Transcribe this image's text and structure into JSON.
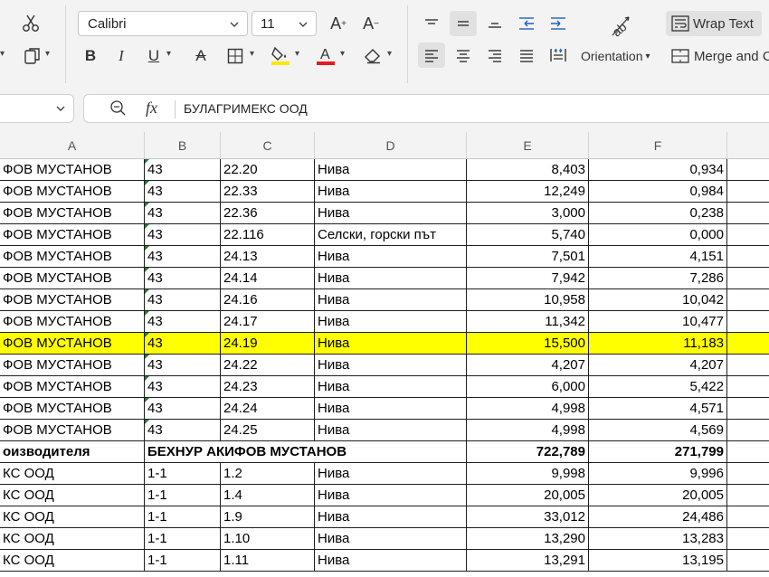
{
  "ribbon": {
    "font_name": "Calibri",
    "font_size": "11",
    "wrap_text_label": "Wrap Text",
    "orientation_label": "Orientation",
    "merge_label": "Merge and Ce",
    "accent_font_color": "#e51c23",
    "accent_fill_color": "#ffe600"
  },
  "formula_bar": {
    "fx_label": "fx",
    "content": "БУЛАГРИМЕКС ООД"
  },
  "columns": [
    "A",
    "B",
    "C",
    "D",
    "E",
    "F"
  ],
  "rows": [
    {
      "a": "ФОВ МУСТАНОВ",
      "b": "43",
      "c": "22.20",
      "d": "Нива",
      "e": "8,403",
      "f": "0,934",
      "mark": true
    },
    {
      "a": "ФОВ МУСТАНОВ",
      "b": "43",
      "c": "22.33",
      "d": "Нива",
      "e": "12,249",
      "f": "0,984",
      "mark": true
    },
    {
      "a": "ФОВ МУСТАНОВ",
      "b": "43",
      "c": "22.36",
      "d": "Нива",
      "e": "3,000",
      "f": "0,238",
      "mark": true
    },
    {
      "a": "ФОВ МУСТАНОВ",
      "b": "43",
      "c": "22.116",
      "d": "Селски, горски път",
      "e": "5,740",
      "f": "0,000",
      "mark": true
    },
    {
      "a": "ФОВ МУСТАНОВ",
      "b": "43",
      "c": "24.13",
      "d": "Нива",
      "e": "7,501",
      "f": "4,151",
      "mark": true
    },
    {
      "a": "ФОВ МУСТАНОВ",
      "b": "43",
      "c": "24.14",
      "d": "Нива",
      "e": "7,942",
      "f": "7,286",
      "mark": true
    },
    {
      "a": "ФОВ МУСТАНОВ",
      "b": "43",
      "c": "24.16",
      "d": "Нива",
      "e": "10,958",
      "f": "10,042",
      "mark": true
    },
    {
      "a": "ФОВ МУСТАНОВ",
      "b": "43",
      "c": "24.17",
      "d": "Нива",
      "e": "11,342",
      "f": "10,477",
      "mark": true
    },
    {
      "a": "ФОВ МУСТАНОВ",
      "b": "43",
      "c": "24.19",
      "d": "Нива",
      "e": "15,500",
      "f": "11,183",
      "mark": true,
      "highlight": true
    },
    {
      "a": "ФОВ МУСТАНОВ",
      "b": "43",
      "c": "24.22",
      "d": "Нива",
      "e": "4,207",
      "f": "4,207",
      "mark": true
    },
    {
      "a": "ФОВ МУСТАНОВ",
      "b": "43",
      "c": "24.23",
      "d": "Нива",
      "e": "6,000",
      "f": "5,422",
      "mark": true
    },
    {
      "a": "ФОВ МУСТАНОВ",
      "b": "43",
      "c": "24.24",
      "d": "Нива",
      "e": "4,998",
      "f": "4,571",
      "mark": true
    },
    {
      "a": "ФОВ МУСТАНОВ",
      "b": "43",
      "c": "24.25",
      "d": "Нива",
      "e": "4,998",
      "f": "4,569",
      "mark": true
    },
    {
      "a": "оизводителя",
      "b": "БЕХНУР АКИФОВ МУСТАНОВ",
      "c": "",
      "d": "",
      "e": "722,789",
      "f": "271,799",
      "bold": true,
      "span": true
    },
    {
      "a": "КС ООД",
      "b": "1-1",
      "c": "1.2",
      "d": "Нива",
      "e": "9,998",
      "f": "9,996"
    },
    {
      "a": "КС ООД",
      "b": "1-1",
      "c": "1.4",
      "d": "Нива",
      "e": "20,005",
      "f": "20,005"
    },
    {
      "a": "КС ООД",
      "b": "1-1",
      "c": "1.9",
      "d": "Нива",
      "e": "33,012",
      "f": "24,486"
    },
    {
      "a": "КС ООД",
      "b": "1-1",
      "c": "1.10",
      "d": "Нива",
      "e": "13,290",
      "f": "13,283"
    },
    {
      "a": "КС ООД",
      "b": "1-1",
      "c": "1.11",
      "d": "Нива",
      "e": "13,291",
      "f": "13,195"
    }
  ]
}
